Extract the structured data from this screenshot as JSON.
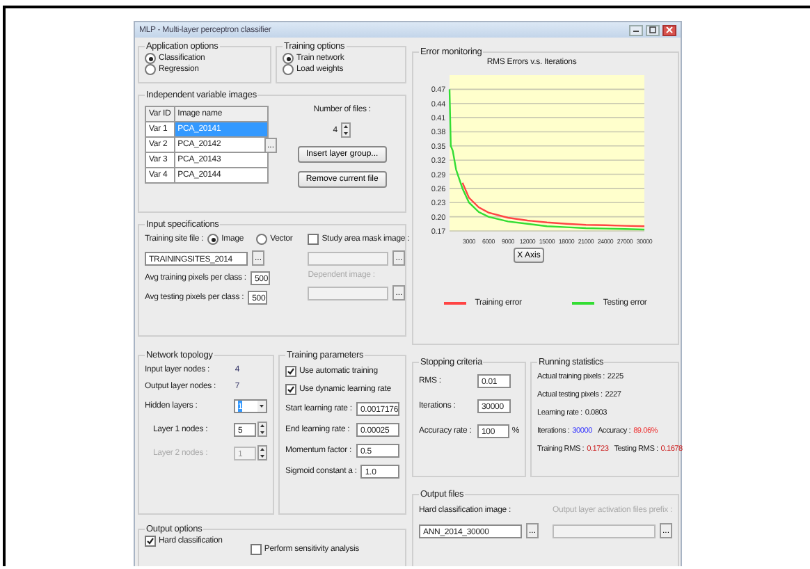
{
  "window": {
    "title": "MLP - Multi-layer perceptron classifier"
  },
  "application_options": {
    "title": "Application options",
    "options": [
      {
        "label": "Classification",
        "selected": true
      },
      {
        "label": "Regression",
        "selected": false
      }
    ]
  },
  "training_options": {
    "title": "Training options",
    "options": [
      {
        "label": "Train network",
        "selected": true
      },
      {
        "label": "Load weights",
        "selected": false
      }
    ]
  },
  "independent_images": {
    "title": "Independent variable images",
    "columns": [
      "Var ID",
      "Image name"
    ],
    "rows": [
      {
        "var_id": "Var 1",
        "image": "PCA_20141",
        "selected": true
      },
      {
        "var_id": "Var 2",
        "image": "PCA_20142",
        "selected": false
      },
      {
        "var_id": "Var 3",
        "image": "PCA_20143",
        "selected": false
      },
      {
        "var_id": "Var 4",
        "image": "PCA_20144",
        "selected": false
      }
    ],
    "cell_button": "...",
    "files_label": "Number of files :",
    "files_count": "4",
    "buttons": [
      "Insert layer group...",
      "Remove current file"
    ]
  },
  "input_specifications": {
    "title": "Input specifications",
    "site_label": "Training site file :",
    "site_types": [
      {
        "label": "Image",
        "selected": true
      },
      {
        "label": "Vector",
        "selected": false
      }
    ],
    "site_file": "TRAININGSITES_2014",
    "browse": "...",
    "mask": {
      "label": "Study area mask image :",
      "checked": false
    },
    "dependent_label": "Dependent image :",
    "avg": [
      {
        "label": "Avg training pixels per class :",
        "value": "500"
      },
      {
        "label": "Avg testing pixels per class :",
        "value": "500"
      }
    ]
  },
  "error_monitoring": {
    "title": "Error monitoring",
    "chart_data": {
      "type": "line",
      "title": "RMS Errors v.s. Iterations",
      "xlabel": "X Axis",
      "x": [
        0,
        200,
        500,
        1000,
        2000,
        3000,
        4500,
        6000,
        9000,
        12000,
        15000,
        18000,
        21000,
        24000,
        27000,
        30000
      ],
      "series": [
        {
          "name": "Training error",
          "color": "#ff4444",
          "values": [
            null,
            null,
            null,
            null,
            0.272,
            0.24,
            0.22,
            0.209,
            0.198,
            0.192,
            0.188,
            0.185,
            0.183,
            0.182,
            0.181,
            0.18
          ]
        },
        {
          "name": "Testing error",
          "color": "#33dd33",
          "values": [
            0.47,
            0.35,
            0.34,
            0.3,
            0.26,
            0.23,
            0.21,
            0.2,
            0.19,
            0.185,
            0.18,
            0.178,
            0.176,
            0.175,
            0.174,
            0.173
          ]
        }
      ],
      "xlim": [
        0,
        30000
      ],
      "ylim": [
        0.17,
        0.5
      ],
      "xticks": [
        3000,
        6000,
        9000,
        12000,
        15000,
        18000,
        21000,
        24000,
        27000,
        30000
      ],
      "yticks": [
        0.47,
        0.44,
        0.41,
        0.38,
        0.35,
        0.32,
        0.29,
        0.26,
        0.23,
        {
          "value": 0.2,
          "label": "0.20"
        },
        0.17
      ],
      "grid": true
    }
  },
  "network_topology": {
    "title": "Network topology",
    "input_nodes": {
      "label": "Input layer nodes :",
      "value": "4"
    },
    "output_nodes": {
      "label": "Output layer nodes :",
      "value": "7"
    },
    "hidden_layers": {
      "label": "Hidden layers :",
      "value": "1"
    },
    "layer_nodes": [
      {
        "label": "Layer 1 nodes :",
        "value": "5",
        "disabled": false
      },
      {
        "label": "Layer 2 nodes :",
        "value": "1",
        "disabled": true
      }
    ]
  },
  "training_parameters": {
    "title": "Training parameters",
    "checks": [
      {
        "label": "Use automatic training",
        "checked": true
      },
      {
        "label": "Use dynamic learning rate",
        "checked": true
      }
    ],
    "fields": [
      {
        "label": "Start learning rate :",
        "value": "0.0017176"
      },
      {
        "label": "End learning rate :",
        "value": "0.00025"
      },
      {
        "label": "Momentum factor :",
        "value": "0.5"
      },
      {
        "label": "Sigmoid constant a :",
        "value": "1.0"
      }
    ]
  },
  "stopping_criteria": {
    "title": "Stopping criteria",
    "fields": [
      {
        "label": "RMS :",
        "value": "0.01"
      },
      {
        "label": "Iterations :",
        "value": "30000"
      },
      {
        "label": "Accuracy rate :",
        "value": "100",
        "unit": "%"
      }
    ]
  },
  "running_statistics": {
    "title": "Running statistics",
    "rows": [
      {
        "stats": [
          {
            "label": "Actual training pixels :",
            "value": "2225",
            "color": "#222222"
          }
        ]
      },
      {
        "stats": [
          {
            "label": "Actual testing pixels :",
            "value": "2227",
            "color": "#222222"
          }
        ]
      },
      {
        "stats": [
          {
            "label": "Learning rate :",
            "value": "0.0803",
            "color": "#222222"
          }
        ]
      },
      {
        "stats": [
          {
            "label": "Iterations :",
            "value": "30000",
            "color": "#3333ff"
          },
          {
            "label": "Accuracy :",
            "value": "89.06%",
            "color": "#ee3333"
          }
        ]
      },
      {
        "stats": [
          {
            "label": "Training RMS :",
            "value": "0.1723",
            "color": "#cc2222"
          },
          {
            "label": "Testing RMS :",
            "value": "0.1678",
            "color": "#cc2222"
          }
        ]
      }
    ]
  },
  "output_files": {
    "title": "Output files",
    "hard_label": "Hard classification image :",
    "hard_value": "ANN_2014_30000",
    "browse": "...",
    "activation_label": "Output layer activation files prefix :"
  },
  "output_options": {
    "title": "Output options",
    "checks": [
      {
        "label": "Hard classification",
        "checked": true
      },
      {
        "label": "Perform sensitivity analysis",
        "checked": false
      }
    ]
  }
}
